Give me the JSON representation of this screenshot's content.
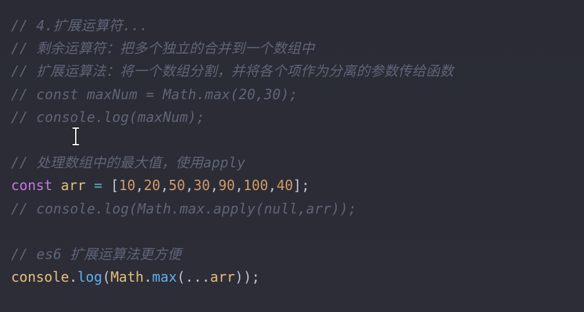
{
  "editor": {
    "lines": [
      {
        "type": "comment",
        "text": "// 4.扩展运算符..."
      },
      {
        "type": "comment",
        "text": "// 剩余运算符：把多个独立的合并到一个数组中"
      },
      {
        "type": "comment",
        "text": "// 扩展运算法：将一个数组分割，并将各个项作为分离的参数传给函数"
      },
      {
        "type": "comment",
        "text": "// const maxNum = Math.max(20,30);"
      },
      {
        "type": "comment",
        "text": "// console.log(maxNum);"
      },
      {
        "type": "blank",
        "text": ""
      },
      {
        "type": "comment",
        "text": "// 处理数组中的最大值，使用apply"
      },
      {
        "type": "code",
        "tokens": [
          {
            "k": "kw",
            "t": "const"
          },
          {
            "k": "pun",
            "t": " "
          },
          {
            "k": "var",
            "t": "arr"
          },
          {
            "k": "pun",
            "t": " "
          },
          {
            "k": "op",
            "t": "="
          },
          {
            "k": "pun",
            "t": " ["
          },
          {
            "k": "num",
            "t": "10"
          },
          {
            "k": "pun",
            "t": ","
          },
          {
            "k": "num",
            "t": "20"
          },
          {
            "k": "pun",
            "t": ","
          },
          {
            "k": "num",
            "t": "50"
          },
          {
            "k": "pun",
            "t": ","
          },
          {
            "k": "num",
            "t": "30"
          },
          {
            "k": "pun",
            "t": ","
          },
          {
            "k": "num",
            "t": "90"
          },
          {
            "k": "pun",
            "t": ","
          },
          {
            "k": "num",
            "t": "100"
          },
          {
            "k": "pun",
            "t": ","
          },
          {
            "k": "num",
            "t": "40"
          },
          {
            "k": "pun",
            "t": "];"
          }
        ]
      },
      {
        "type": "comment",
        "text": "// console.log(Math.max.apply(null,arr));"
      },
      {
        "type": "blank",
        "text": ""
      },
      {
        "type": "comment",
        "text": "// es6 扩展运算法更方便"
      },
      {
        "type": "code",
        "tokens": [
          {
            "k": "plain",
            "t": "console"
          },
          {
            "k": "pun",
            "t": "."
          },
          {
            "k": "fn",
            "t": "log"
          },
          {
            "k": "pun",
            "t": "("
          },
          {
            "k": "plain",
            "t": "Math"
          },
          {
            "k": "pun",
            "t": "."
          },
          {
            "k": "fn",
            "t": "max"
          },
          {
            "k": "pun",
            "t": "(..."
          },
          {
            "k": "plain",
            "t": "arr"
          },
          {
            "k": "pun",
            "t": "));"
          }
        ]
      }
    ]
  },
  "colors": {
    "background": "#2b2c36",
    "comment": "#5f6578",
    "keyword": "#c678dd",
    "variable": "#e5c07b",
    "operator": "#56b6c2",
    "number": "#d19a66",
    "function": "#61afef",
    "punctuation": "#c0c4d0"
  },
  "cursor": {
    "icon": "text-cursor-icon"
  }
}
